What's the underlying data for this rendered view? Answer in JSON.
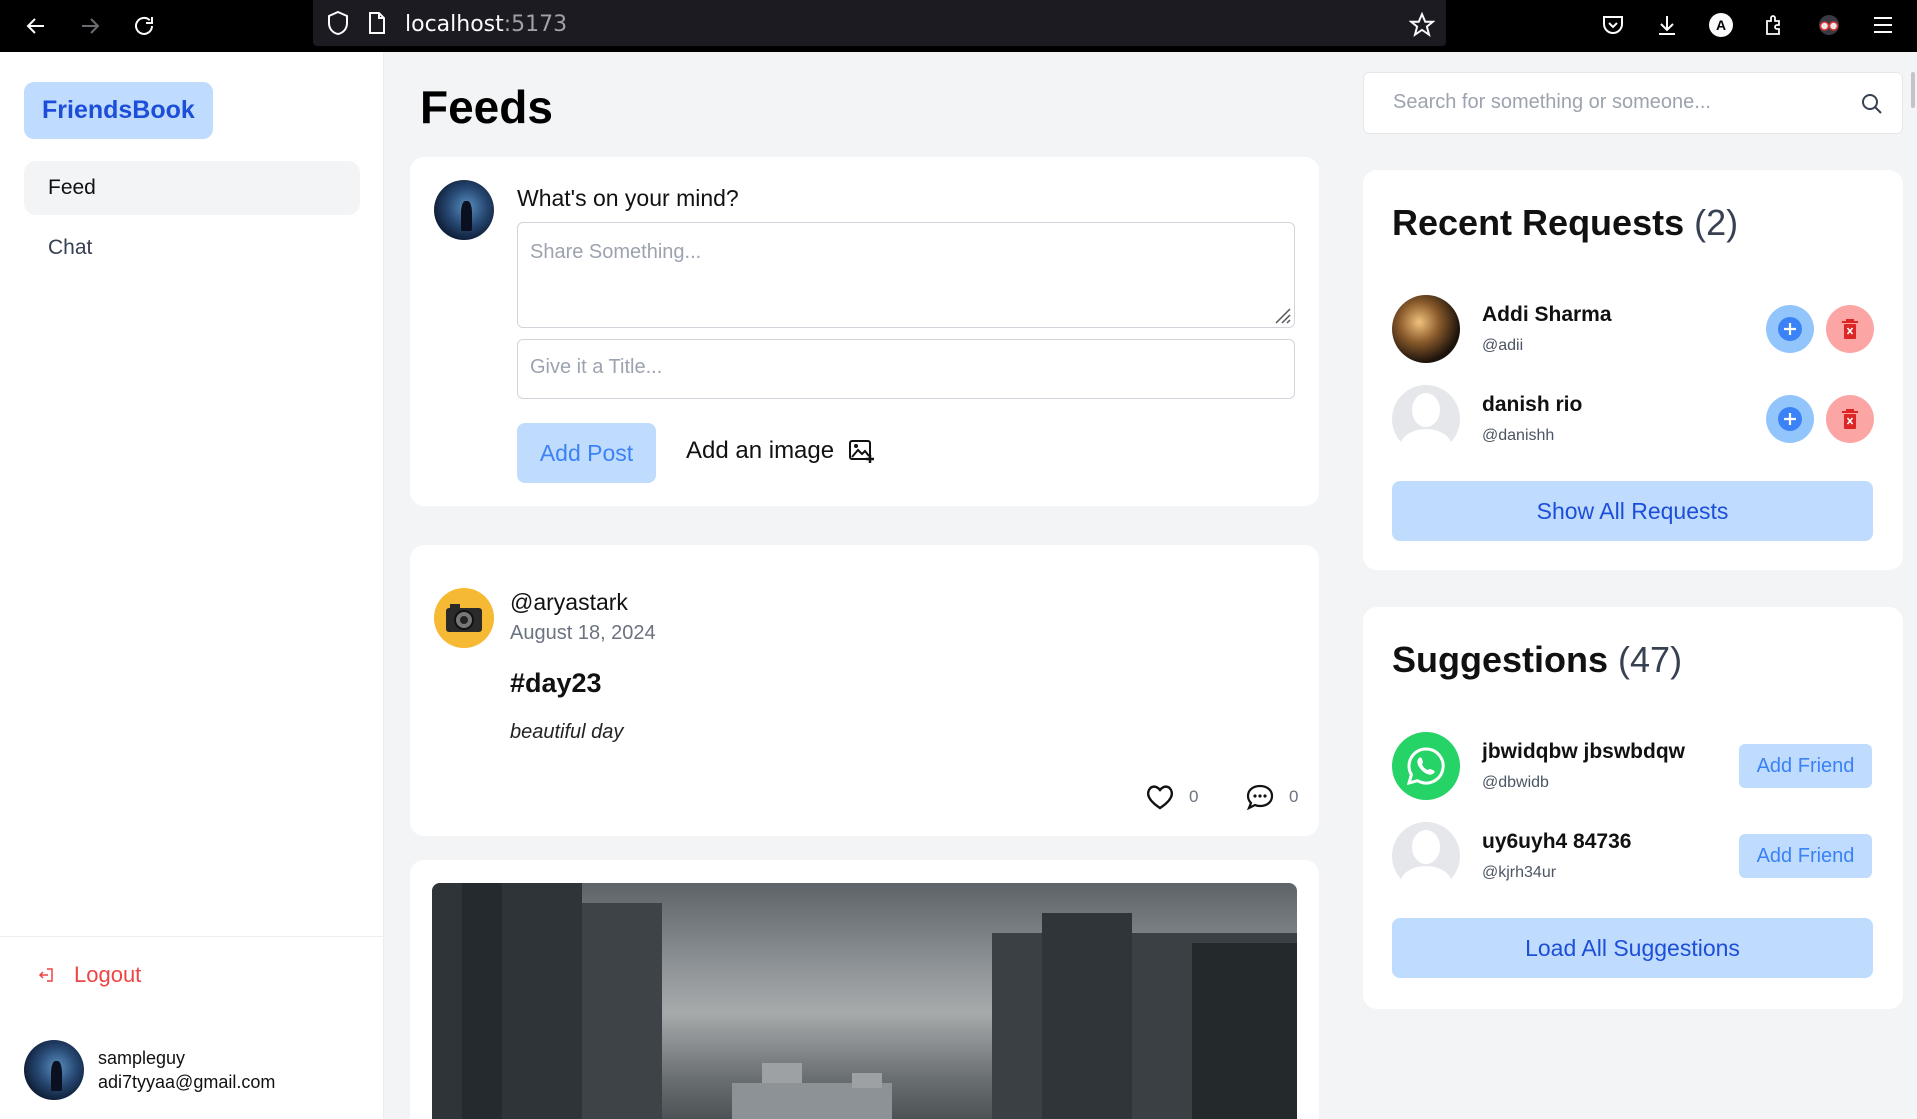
{
  "browser": {
    "url_host": "localhost",
    "url_port": ":5173",
    "toolbar_badge": "A"
  },
  "sidebar": {
    "brand": "FriendsBook",
    "items": [
      {
        "label": "Feed",
        "active": true
      },
      {
        "label": "Chat",
        "active": false
      }
    ],
    "logout_label": "Logout",
    "user": {
      "name": "sampleguy",
      "email": "adi7tyyaa@gmail.com"
    }
  },
  "main": {
    "title": "Feeds",
    "composer": {
      "prompt": "What's on your mind?",
      "content_placeholder": "Share Something...",
      "title_placeholder": "Give it a Title...",
      "submit_label": "Add Post",
      "image_label": "Add an image"
    },
    "posts": [
      {
        "username": "@aryastark",
        "date": "August 18, 2024",
        "title": "#day23",
        "body": "beautiful day",
        "likes": "0",
        "comments": "0"
      }
    ]
  },
  "right": {
    "search_placeholder": "Search for something or someone...",
    "requests": {
      "title": "Recent Requests",
      "count": "(2)",
      "items": [
        {
          "name": "Addi Sharma",
          "handle": "@adii"
        },
        {
          "name": "danish rio",
          "handle": "@danishh"
        }
      ],
      "show_all_label": "Show All Requests"
    },
    "suggestions": {
      "title": "Suggestions",
      "count": "(47)",
      "items": [
        {
          "name": "jbwidqbw jbswbdqw",
          "handle": "@dbwidb",
          "action": "Add Friend"
        },
        {
          "name": "uy6uyh4 84736",
          "handle": "@kjrh34ur",
          "action": "Add Friend"
        }
      ],
      "load_all_label": "Load All Suggestions"
    }
  },
  "colors": {
    "accent_light": "#bfdbfe",
    "accent": "#3b82f6",
    "danger": "#ef4444"
  }
}
